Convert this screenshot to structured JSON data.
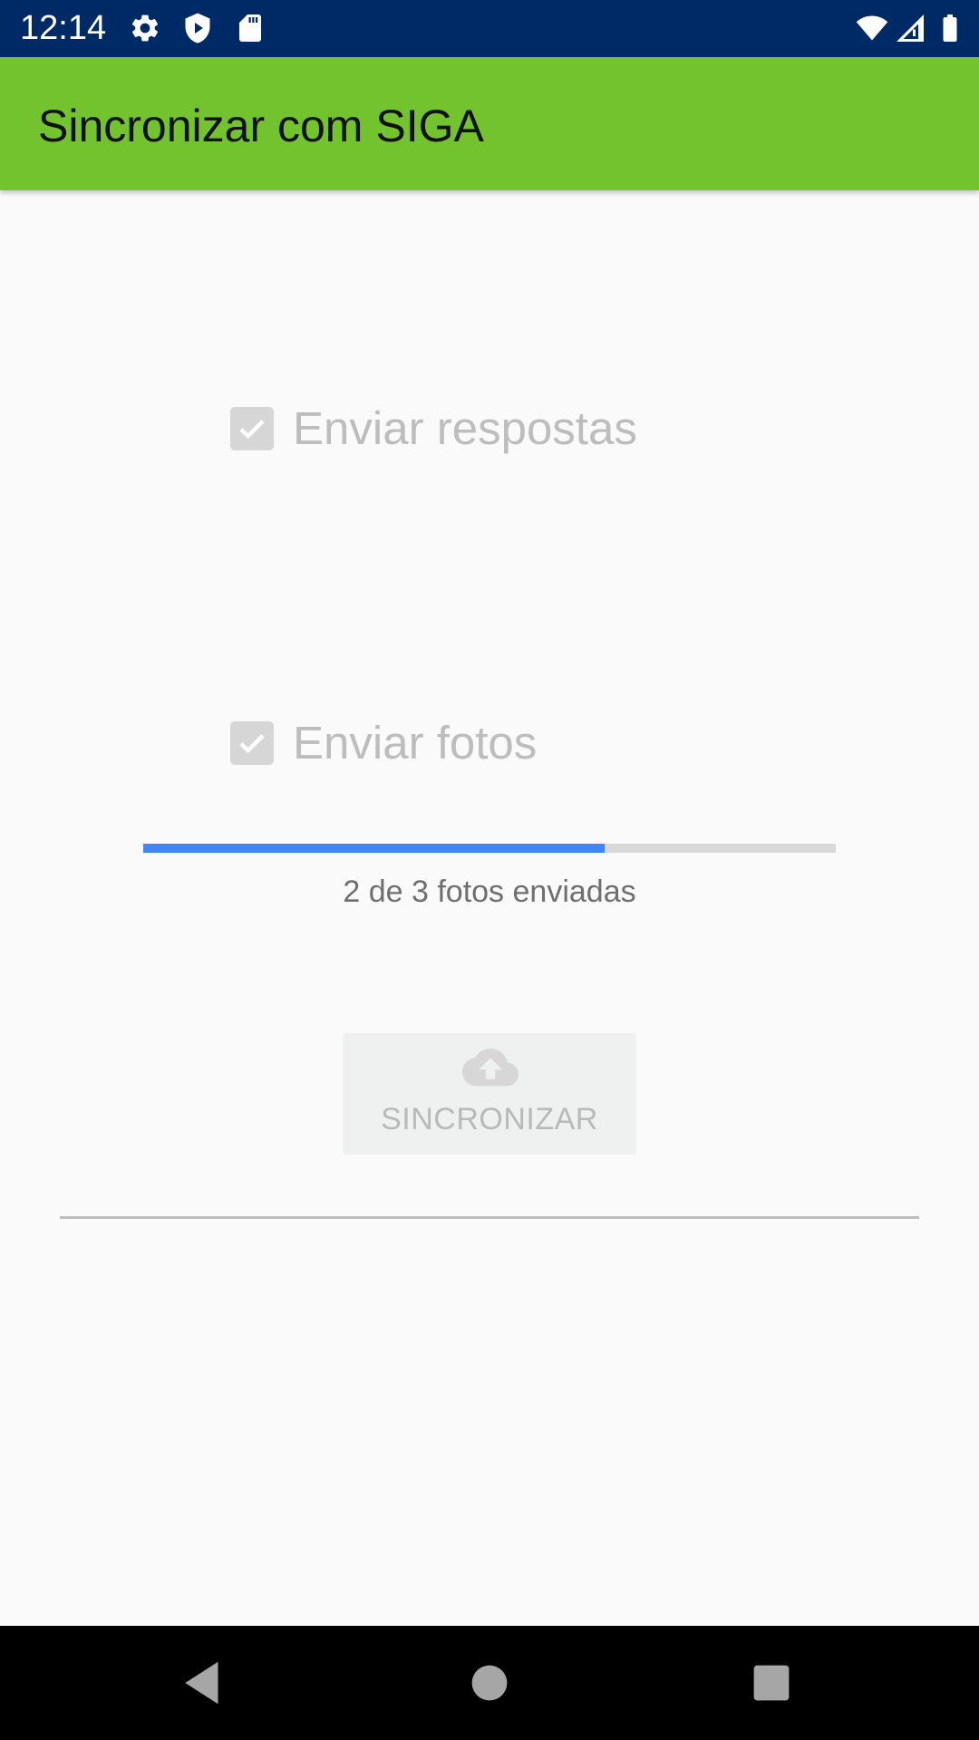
{
  "status_bar": {
    "time": "12:14",
    "left_icons": [
      "gear-icon",
      "shield-play-icon",
      "sd-card-icon"
    ],
    "right_icons": [
      "wifi-icon",
      "signal-icon",
      "battery-icon"
    ]
  },
  "app_bar": {
    "title": "Sincronizar com SIGA",
    "background_color": "#72C32D"
  },
  "options": {
    "send_answers": {
      "label": "Enviar respostas",
      "checked": true,
      "enabled": false
    },
    "send_photos": {
      "label": "Enviar fotos",
      "checked": true,
      "enabled": false
    }
  },
  "progress": {
    "fraction": 0.6667,
    "text": "2 de 3 fotos enviadas",
    "color": "#4285F4"
  },
  "sync_button": {
    "label": "SINCRONIZAR",
    "icon": "cloud-upload-icon",
    "enabled": false
  },
  "nav_bar": {
    "buttons": [
      "back-icon",
      "home-icon",
      "recents-icon"
    ]
  }
}
